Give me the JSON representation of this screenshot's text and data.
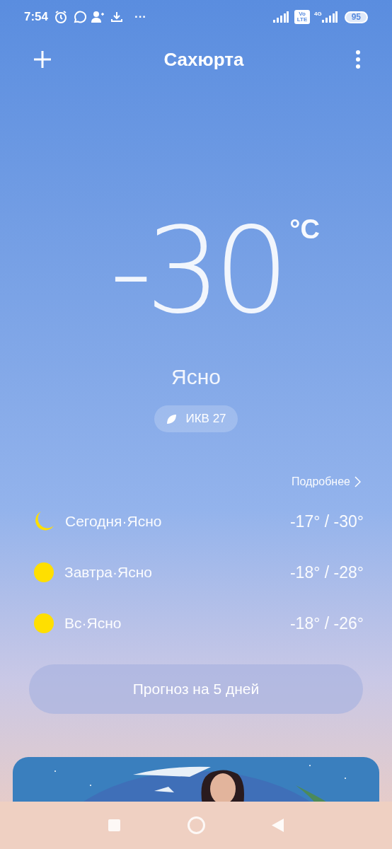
{
  "status_bar": {
    "time": "7:54",
    "more": "···",
    "volte": [
      "Vo",
      "LTE"
    ],
    "network": "4G",
    "battery": "95"
  },
  "header": {
    "title": "Сахюрта"
  },
  "current": {
    "temperature": "-30",
    "unit": "°C",
    "condition": "Ясно",
    "aqi": "ИКВ 27"
  },
  "details_link": "Подробнее",
  "forecast": [
    {
      "kind": "night",
      "label": "Сегодня·Ясно",
      "range": "-17° / -30°"
    },
    {
      "kind": "day",
      "label": "Завтра·Ясно",
      "range": "-18° / -28°"
    },
    {
      "kind": "day",
      "label": "Вс·Ясно",
      "range": "-18° / -26°"
    }
  ],
  "forecast_button": "Прогноз на 5 дней"
}
